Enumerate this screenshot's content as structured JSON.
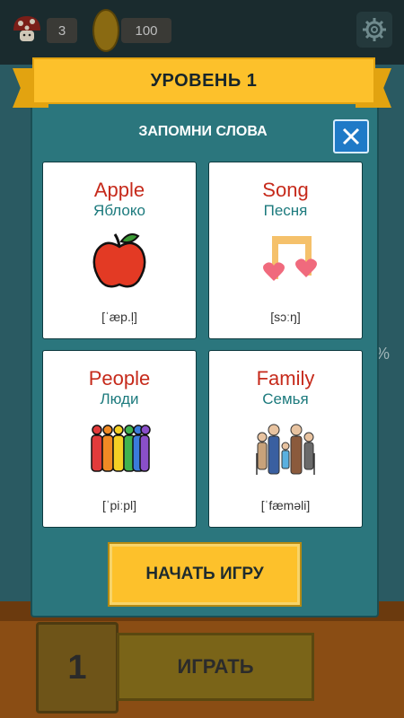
{
  "hud": {
    "lives": "3",
    "coins": "100"
  },
  "background": {
    "level_number": "1",
    "play_label": "ИГРАТЬ",
    "side_symbol": "%"
  },
  "modal": {
    "ribbon_title": "УРОВЕНЬ 1",
    "title": "ЗАПОМНИ СЛОВА",
    "start_label": "НАЧАТЬ ИГРУ",
    "cards": [
      {
        "en": "Apple",
        "ru": "Яблоко",
        "ipa": "[ˈæp.l̩]",
        "icon": "apple-icon"
      },
      {
        "en": "Song",
        "ru": "Песня",
        "ipa": "[sɔːŋ]",
        "icon": "music-note-icon"
      },
      {
        "en": "People",
        "ru": "Люди",
        "ipa": "[ˈpiːpl]",
        "icon": "people-icon"
      },
      {
        "en": "Family",
        "ru": "Семья",
        "ipa": "[ˈfæməli]",
        "icon": "family-icon"
      }
    ]
  },
  "colors": {
    "panel": "#2b767d",
    "ribbon": "#fdc12b",
    "english_word": "#c62a1b",
    "russian_word": "#1c7a7d",
    "close_button": "#1f7ac7"
  }
}
